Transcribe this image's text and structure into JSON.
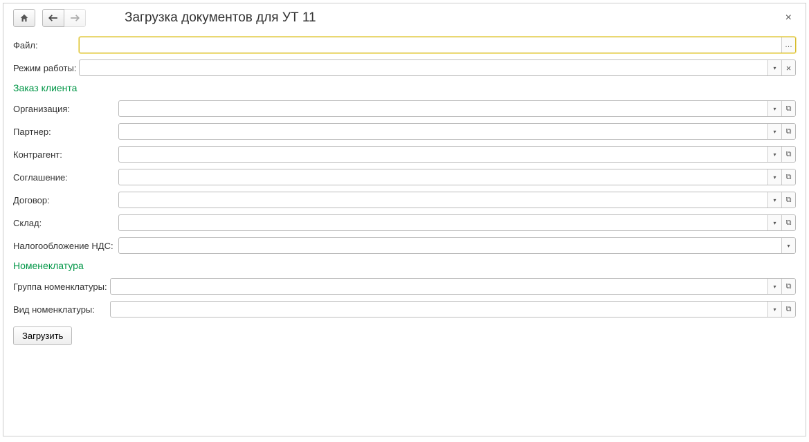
{
  "title": "Загрузка документов для УТ 11",
  "fields": {
    "file": {
      "label": "Файл:",
      "value": ""
    },
    "mode": {
      "label": "Режим работы:",
      "value": ""
    }
  },
  "section_order": {
    "title": "Заказ клиента",
    "org": {
      "label": "Организация:",
      "value": ""
    },
    "partner": {
      "label": "Партнер:",
      "value": ""
    },
    "contragent": {
      "label": "Контрагент:",
      "value": ""
    },
    "agreement": {
      "label": "Соглашение:",
      "value": ""
    },
    "contract": {
      "label": "Договор:",
      "value": ""
    },
    "warehouse": {
      "label": "Склад:",
      "value": ""
    },
    "vat": {
      "label": "Налогообложение НДС:",
      "value": ""
    }
  },
  "section_nomen": {
    "title": "Номенеклатура",
    "group": {
      "label": "Группа номенклатуры:",
      "value": ""
    },
    "type": {
      "label": "Вид номенклатуры:",
      "value": ""
    }
  },
  "actions": {
    "load": "Загрузить"
  }
}
